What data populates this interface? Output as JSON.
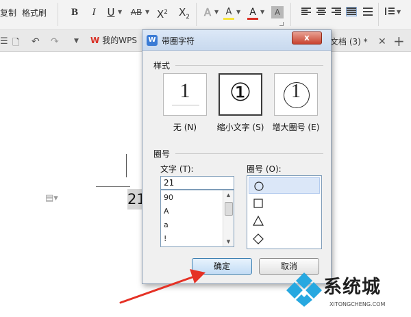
{
  "ribbon": {
    "copy_label": "复制",
    "format_painter_label": "格式刷",
    "bold": "B",
    "italic": "I",
    "underline": "U",
    "strikethrough": "AB",
    "superscript_base": "X",
    "superscript_mark": "2",
    "subscript_base": "X",
    "subscript_mark": "2",
    "text_effect": "A",
    "highlight": "A",
    "font_color": "A",
    "char_shading": "A",
    "font_color_hex": "#d93025",
    "highlight_color_hex": "#f7e43a"
  },
  "tabbar": {
    "wps_tab_label": "我的WPS",
    "doc_tab_label": "文档 (3) *",
    "close_glyph": "✕",
    "new_tab_glyph": "+"
  },
  "document": {
    "content_text": "21"
  },
  "dialog": {
    "title": "带圈字符",
    "logo_letter": "W",
    "close_glyph": "x",
    "style_group_label": "样式",
    "style_options": [
      {
        "label": "无 (N)",
        "preview": "1"
      },
      {
        "label": "缩小文字 (S)",
        "preview": "①"
      },
      {
        "label": "增大圈号 (E)",
        "preview": "1"
      }
    ],
    "enclosure_group_label": "圈号",
    "text_label": "文字 (T):",
    "text_value": "21",
    "text_list": [
      "90",
      "A",
      "a",
      "!"
    ],
    "enclosure_label": "圈号 (O):",
    "enclosure_shapes": [
      "circle",
      "square",
      "triangle",
      "diamond"
    ],
    "ok_label": "确定",
    "cancel_label": "取消"
  },
  "watermark": {
    "brand": "系统城",
    "url": "XITONGCHENG.COM"
  }
}
